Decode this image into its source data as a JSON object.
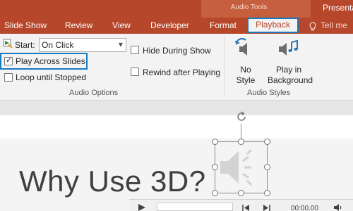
{
  "titlebar": {
    "context_group_label": "Audio Tools",
    "document_title": "Presenta"
  },
  "tabs": [
    {
      "label": "Slide Show"
    },
    {
      "label": "Review"
    },
    {
      "label": "View"
    },
    {
      "label": "Developer"
    },
    {
      "label": "Format"
    },
    {
      "label": "Playback",
      "selected": true
    }
  ],
  "tell_me": {
    "label": "Tell me",
    "icon": "lightbulb-icon"
  },
  "audio_options": {
    "start_label": "Start:",
    "start_value": "On Click",
    "play_across_slides": {
      "label": "Play Across Slides",
      "checked": true
    },
    "loop_until_stopped": {
      "label": "Loop until Stopped",
      "checked": false
    },
    "hide_during_show": {
      "label": "Hide During Show",
      "checked": false
    },
    "rewind_after_playing": {
      "label": "Rewind after Playing",
      "checked": false
    },
    "group_label": "Audio Options"
  },
  "audio_styles": {
    "no_style": {
      "line1": "No",
      "line2": "Style",
      "icon": "speaker-undo-icon"
    },
    "play_in_background": {
      "line1": "Play in",
      "line2": "Background",
      "icon": "speaker-music-icon"
    },
    "group_label": "Audio Styles"
  },
  "slide": {
    "title": "Why Use 3D?"
  },
  "player": {
    "time": "00:00.00"
  },
  "colors": {
    "ribbon_accent": "#b7472a",
    "highlight": "#1a7abf"
  }
}
